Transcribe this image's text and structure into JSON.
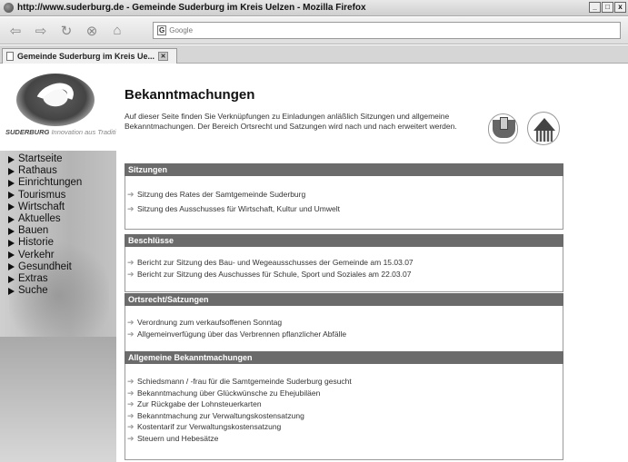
{
  "window": {
    "title": "http://www.suderburg.de - Gemeinde Suderburg im Kreis Uelzen - Mozilla Firefox",
    "controls": [
      "_",
      "□",
      "x"
    ]
  },
  "navbar": {
    "search_engine_label": "G",
    "search_placeholder": "Google"
  },
  "tab": {
    "title": "Gemeinde Suderburg im Kreis Ue..."
  },
  "logo": {
    "name": "SUDERBURG",
    "slogan": "Innovation aus Tradition"
  },
  "sidebar": {
    "menu": [
      "Startseite",
      "Rathaus",
      "Einrichtungen",
      "Tourismus",
      "Wirtschaft",
      "Aktuelles",
      "Bauen",
      "Historie",
      "Verkehr",
      "Gesundheit",
      "Extras",
      "Suche"
    ]
  },
  "main": {
    "title": "Bekanntmachungen",
    "intro": "Auf dieser Seite finden Sie Verknüpfungen zu Einladungen anläßlich Sitzungen und allgemeine Bekanntmachungen. Der Bereich Ortsrecht und Satzungen wird nach und nach erweitert werden.",
    "sections": [
      {
        "header": "Sitzungen",
        "items": [
          "Sitzung des Rates der Samtgemeinde Suderburg",
          "Sitzung des Ausschusses für Wirtschaft, Kultur und Umwelt"
        ]
      },
      {
        "header": "Beschlüsse",
        "items": [
          "Bericht zur Sitzung des Bau- und Wegeausschusses der Gemeinde am 15.03.07",
          "Bericht zur Sitzung des Auschusses für Schule, Sport und Soziales am 22.03.07"
        ]
      },
      {
        "header": "Ortsrecht/Satzungen",
        "items": [
          "Verordnung zum verkaufsoffenen Sonntag",
          "Allgemeinverfügung über das Verbrennen pflanzlicher Abfälle"
        ]
      },
      {
        "header": "Allgemeine Bekanntmachungen",
        "items": [
          "Schiedsmann / -frau für die Samtgemeinde Suderburg gesucht",
          "Bekanntmachung über Glückwünsche zu Ehejubiläen",
          "Zur Rückgabe der Lohnsteuerkarten",
          "Bekanntmachung zur Verwaltungskostensatzung",
          "Kostentarif zur Verwaltungskostensatzung",
          "Steuern und Hebesätze"
        ]
      }
    ]
  }
}
